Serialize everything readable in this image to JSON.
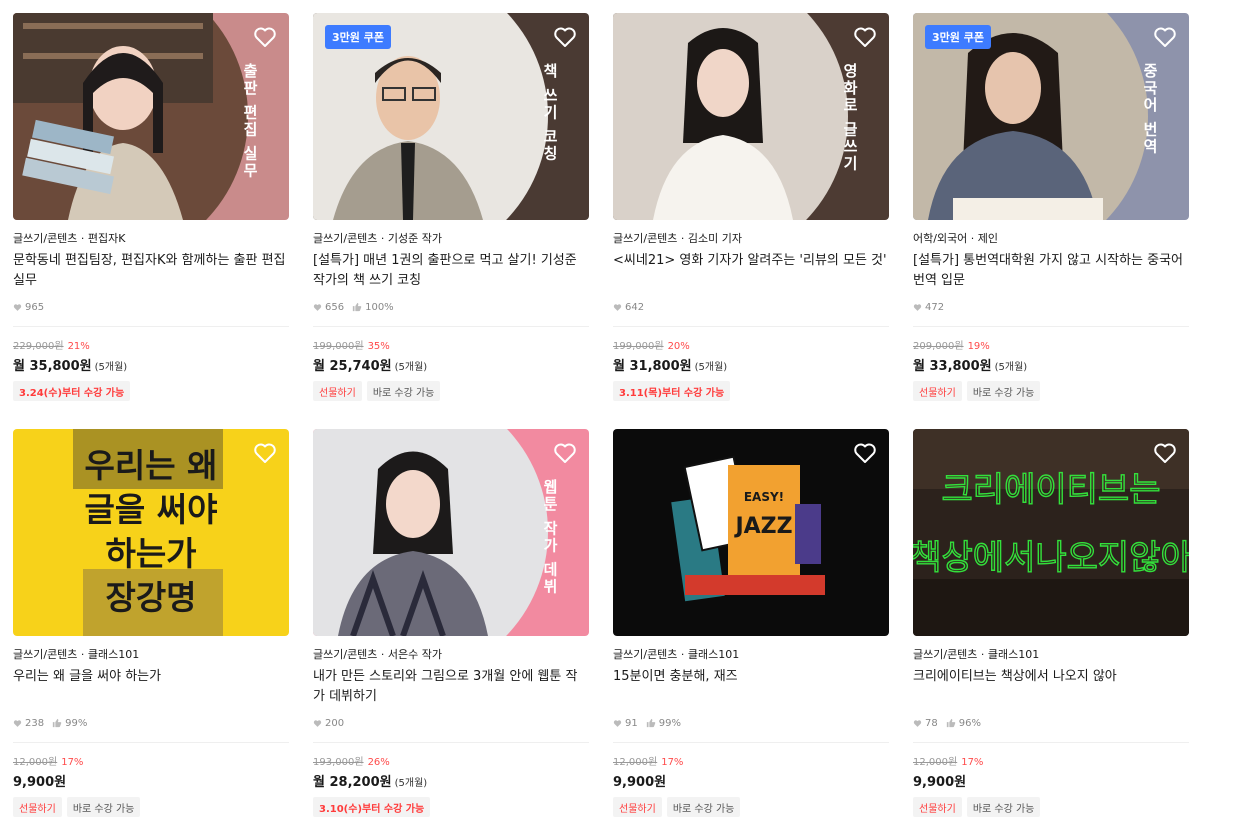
{
  "courses": [
    {
      "thumb_text": "출판 편집 실무",
      "coupon": "",
      "category": "글쓰기/콘텐츠 · 편집자K",
      "title": "문학동네 편집팀장, 편집자K와 함께하는 출판 편집 실무",
      "likes": "965",
      "rating": "",
      "original_price": "229,000원",
      "discount": "21%",
      "price": "월 35,800원",
      "months": "(5개월)",
      "badge1": "3.24(수)부터 수강 가능",
      "badge2": ""
    },
    {
      "thumb_text": "책 쓰기 코칭",
      "coupon": "3만원 쿠폰",
      "category": "글쓰기/콘텐츠 · 기성준 작가",
      "title": "[설특가] 매년 1권의 출판으로 먹고 살기! 기성준 작가의 책 쓰기 코칭",
      "likes": "656",
      "rating": "100%",
      "original_price": "199,000원",
      "discount": "35%",
      "price": "월 25,740원",
      "months": "(5개월)",
      "badge1": "선물하기",
      "badge2": "바로 수강 가능"
    },
    {
      "thumb_text": "영화로 글쓰기",
      "coupon": "",
      "category": "글쓰기/콘텐츠 · 김소미 기자",
      "title": "<씨네21> 영화 기자가 알려주는 '리뷰의 모든 것'",
      "likes": "642",
      "rating": "",
      "original_price": "199,000원",
      "discount": "20%",
      "price": "월 31,800원",
      "months": "(5개월)",
      "badge1": "3.11(목)부터 수강 가능",
      "badge2": ""
    },
    {
      "thumb_text": "중국어 번역",
      "coupon": "3만원 쿠폰",
      "category": "어학/외국어 · 제인",
      "title": "[설특가] 통번역대학원 가지 않고 시작하는 중국어 번역 입문",
      "likes": "472",
      "rating": "",
      "original_price": "209,000원",
      "discount": "19%",
      "price": "월 33,800원",
      "months": "(5개월)",
      "badge1": "선물하기",
      "badge2": "바로 수강 가능"
    },
    {
      "thumb_text": "우리는 왜 글을 써야 하는가 장강명",
      "coupon": "",
      "category": "글쓰기/콘텐츠 · 클래스101",
      "title": "우리는 왜 글을 써야 하는가",
      "likes": "238",
      "rating": "99%",
      "original_price": "12,000원",
      "discount": "17%",
      "price": "9,900원",
      "months": "",
      "badge1": "선물하기",
      "badge2": "바로 수강 가능"
    },
    {
      "thumb_text": "웹툰 작가 데뷔",
      "coupon": "",
      "category": "글쓰기/콘텐츠 · 서은수 작가",
      "title": "내가 만든 스토리와 그림으로 3개월 안에 웹툰 작가 데뷔하기",
      "likes": "200",
      "rating": "",
      "original_price": "193,000원",
      "discount": "26%",
      "price": "월 28,200원",
      "months": "(5개월)",
      "badge1": "3.10(수)부터 수강 가능",
      "badge2": ""
    },
    {
      "thumb_text": "EASY! JAZZ 15분이면 충분해, 재즈",
      "coupon": "",
      "category": "글쓰기/콘텐츠 · 클래스101",
      "title": "15분이면 충분해, 재즈",
      "likes": "91",
      "rating": "99%",
      "original_price": "12,000원",
      "discount": "17%",
      "price": "9,900원",
      "months": "",
      "badge1": "선물하기",
      "badge2": "바로 수강 가능"
    },
    {
      "thumb_text": "크리에이티브는 책상에서 나오지않아",
      "coupon": "",
      "category": "글쓰기/콘텐츠 · 클래스101",
      "title": "크리에이티브는 책상에서 나오지 않아",
      "likes": "78",
      "rating": "96%",
      "original_price": "12,000원",
      "discount": "17%",
      "price": "9,900원",
      "months": "",
      "badge1": "선물하기",
      "badge2": "바로 수강 가능"
    }
  ],
  "thumb_art": {
    "c0": {
      "bg": "#c98b8b",
      "scene": "#6b4a3a"
    },
    "c1": {
      "bg": "#4a3a33",
      "scene": "#e9e6e1"
    },
    "c2": {
      "bg": "#4d3b33",
      "scene": "#d9d1c9"
    },
    "c3": {
      "bg": "#8e93ab",
      "scene": "#c2b8a8"
    },
    "c4": {
      "bg": "#f7d21a"
    },
    "c5": {
      "bg": "#f28aa0",
      "scene": "#e3e3e5"
    },
    "c6": {
      "bg": "#0b0b0b"
    },
    "c7": {
      "bg": "#2c221c",
      "text": "#33e03b"
    }
  },
  "colors": {
    "discount": "#ff4b4b",
    "coupon": "#3d7bff"
  }
}
